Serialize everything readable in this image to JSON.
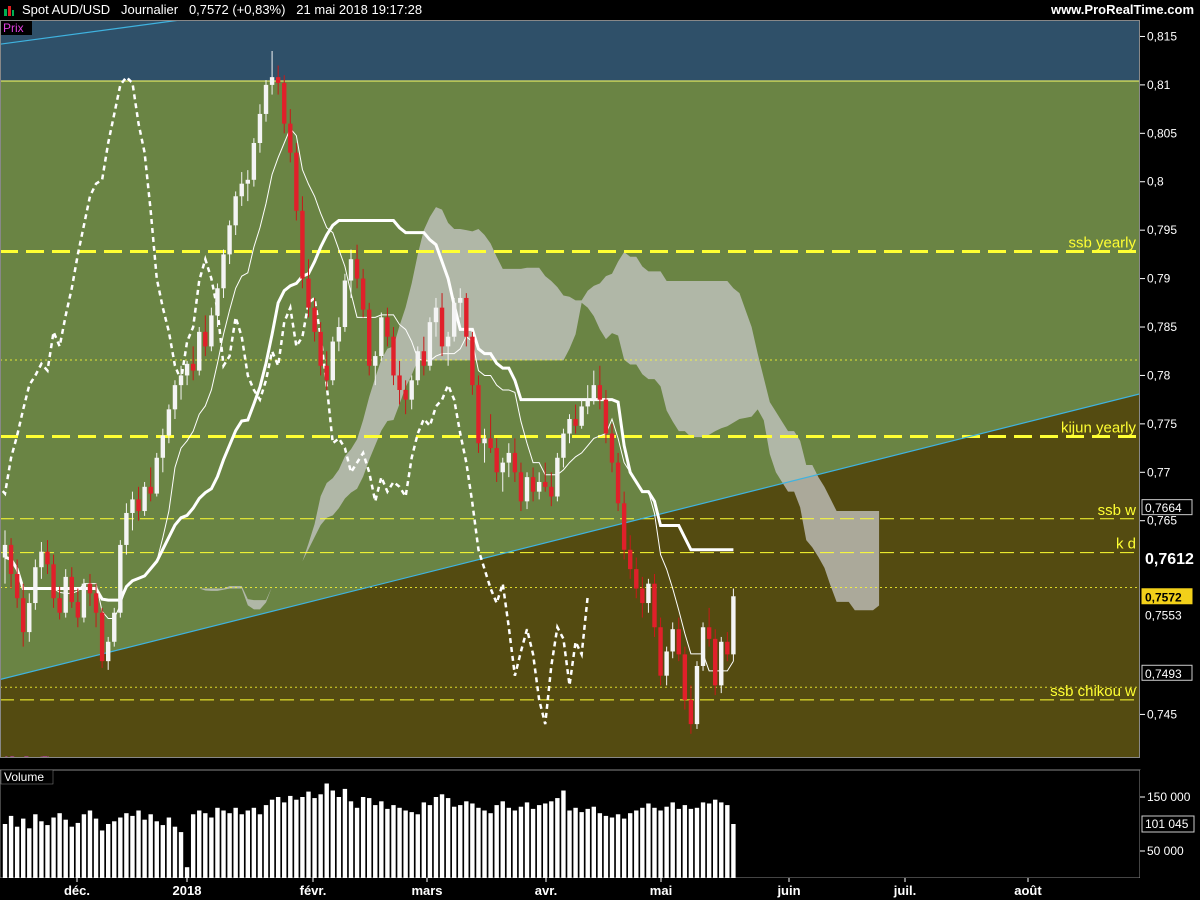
{
  "header": {
    "symbol": "Spot AUD/USD",
    "period": "Journalier",
    "last": "0,7572",
    "change": "(+0,83%)",
    "datetime": "21 mai 2018 19:17:28",
    "brand": "www.ProRealTime.com"
  },
  "price_panel": {
    "label": "Prix",
    "watermark": "©ProRealTime.com",
    "y_ticks": [
      "0,815",
      "0,81",
      "0,805",
      "0,8",
      "0,795",
      "0,79",
      "0,785",
      "0,78",
      "0,775",
      "0,77",
      "0,765",
      "0,745"
    ],
    "levels": [
      {
        "name": "ssb  yearly",
        "value": 0.7928,
        "style": "thick"
      },
      {
        "name": "kijun yearly",
        "value": 0.7737,
        "style": "thick"
      },
      {
        "name": "ssb w",
        "value": 0.7652,
        "style": "thin"
      },
      {
        "name": "k d",
        "value": 0.7617,
        "style": "thin"
      },
      {
        "name": "ssb chikou w",
        "value": 0.7465,
        "style": "thin"
      }
    ],
    "dotted_levels": [
      0.7816,
      0.7581,
      0.7478
    ],
    "value_tags": [
      {
        "text": "0,7664",
        "value": 0.7664,
        "style": "box"
      },
      {
        "text": "0,7612",
        "value": 0.7612,
        "style": "big"
      },
      {
        "text": "0,7572",
        "value": 0.7572,
        "style": "current"
      },
      {
        "text": "0,7553",
        "value": 0.7553,
        "style": "plain"
      },
      {
        "text": "0,7493",
        "value": 0.7493,
        "style": "box"
      }
    ],
    "colors": {
      "top_zone": "#2f5069",
      "mid_zone": "#6a8444",
      "low_zone": "#544b11",
      "level_line": "#ffff33",
      "level_text": "#ffff33",
      "trend": "#3fb3e0",
      "bull": "#f4f4f4",
      "bear": "#e0202a",
      "cloud": "#c8c8c8",
      "kijun": "#ffffff"
    }
  },
  "volume_panel": {
    "label": "Volume",
    "y_ticks": [
      "150 000",
      "50 000"
    ],
    "tag": "101 045",
    "bar_color": "#ffffff"
  },
  "x_axis": {
    "labels": [
      "déc.",
      "2018",
      "févr.",
      "mars",
      "avr.",
      "mai",
      "juin",
      "juil.",
      "août"
    ]
  },
  "chart_data": {
    "type": "candlestick",
    "symbol": "Spot AUD/USD",
    "ylim": [
      0.7405,
      0.8167
    ],
    "ohlc": [
      [
        0.7612,
        0.764,
        0.7585,
        0.7625
      ],
      [
        0.7625,
        0.7632,
        0.758,
        0.7595
      ],
      [
        0.7595,
        0.761,
        0.756,
        0.757
      ],
      [
        0.757,
        0.7585,
        0.752,
        0.7535
      ],
      [
        0.7535,
        0.7575,
        0.7525,
        0.7565
      ],
      [
        0.7565,
        0.761,
        0.7558,
        0.7602
      ],
      [
        0.7602,
        0.7628,
        0.759,
        0.7618
      ],
      [
        0.7618,
        0.763,
        0.7595,
        0.7605
      ],
      [
        0.7605,
        0.7615,
        0.756,
        0.757
      ],
      [
        0.757,
        0.7582,
        0.7548,
        0.7555
      ],
      [
        0.7555,
        0.76,
        0.755,
        0.7592
      ],
      [
        0.7592,
        0.7602,
        0.756,
        0.7566
      ],
      [
        0.7566,
        0.758,
        0.754,
        0.755
      ],
      [
        0.755,
        0.759,
        0.7545,
        0.7585
      ],
      [
        0.7585,
        0.7595,
        0.7562,
        0.7575
      ],
      [
        0.7575,
        0.7585,
        0.754,
        0.7555
      ],
      [
        0.7555,
        0.756,
        0.7498,
        0.7505
      ],
      [
        0.7505,
        0.753,
        0.7496,
        0.7525
      ],
      [
        0.7525,
        0.756,
        0.752,
        0.7555
      ],
      [
        0.7555,
        0.763,
        0.755,
        0.7625
      ],
      [
        0.7625,
        0.7668,
        0.7615,
        0.7658
      ],
      [
        0.7658,
        0.768,
        0.764,
        0.7672
      ],
      [
        0.7672,
        0.7685,
        0.765,
        0.766
      ],
      [
        0.766,
        0.769,
        0.7655,
        0.7685
      ],
      [
        0.7685,
        0.7705,
        0.767,
        0.7678
      ],
      [
        0.7678,
        0.772,
        0.7675,
        0.7715
      ],
      [
        0.7715,
        0.7745,
        0.77,
        0.7738
      ],
      [
        0.7738,
        0.777,
        0.773,
        0.7765
      ],
      [
        0.7765,
        0.7795,
        0.7755,
        0.779
      ],
      [
        0.779,
        0.781,
        0.7775,
        0.78
      ],
      [
        0.78,
        0.7815,
        0.779,
        0.7812
      ],
      [
        0.7812,
        0.783,
        0.7795,
        0.7805
      ],
      [
        0.7805,
        0.785,
        0.78,
        0.7845
      ],
      [
        0.7845,
        0.7862,
        0.782,
        0.783
      ],
      [
        0.783,
        0.787,
        0.7825,
        0.7862
      ],
      [
        0.7862,
        0.7895,
        0.785,
        0.789
      ],
      [
        0.789,
        0.793,
        0.788,
        0.7925
      ],
      [
        0.7925,
        0.796,
        0.7915,
        0.7955
      ],
      [
        0.7955,
        0.799,
        0.7945,
        0.7985
      ],
      [
        0.7985,
        0.801,
        0.7975,
        0.7998
      ],
      [
        0.7998,
        0.8012,
        0.798,
        0.8002
      ],
      [
        0.8002,
        0.8045,
        0.7995,
        0.804
      ],
      [
        0.804,
        0.808,
        0.803,
        0.807
      ],
      [
        0.807,
        0.8105,
        0.8062,
        0.81
      ],
      [
        0.81,
        0.8135,
        0.809,
        0.8108
      ],
      [
        0.8108,
        0.812,
        0.809,
        0.8102
      ],
      [
        0.8102,
        0.811,
        0.805,
        0.806
      ],
      [
        0.806,
        0.8075,
        0.802,
        0.803
      ],
      [
        0.803,
        0.804,
        0.796,
        0.797
      ],
      [
        0.797,
        0.7985,
        0.789,
        0.79
      ],
      [
        0.79,
        0.792,
        0.786,
        0.787
      ],
      [
        0.787,
        0.788,
        0.7835,
        0.7845
      ],
      [
        0.7845,
        0.7855,
        0.78,
        0.781
      ],
      [
        0.781,
        0.7825,
        0.7785,
        0.7795
      ],
      [
        0.7795,
        0.784,
        0.779,
        0.7835
      ],
      [
        0.7835,
        0.786,
        0.7825,
        0.785
      ],
      [
        0.785,
        0.7905,
        0.7845,
        0.7898
      ],
      [
        0.7898,
        0.793,
        0.788,
        0.792
      ],
      [
        0.792,
        0.7935,
        0.789,
        0.79
      ],
      [
        0.79,
        0.791,
        0.786,
        0.7868
      ],
      [
        0.7868,
        0.7875,
        0.78,
        0.781
      ],
      [
        0.781,
        0.7825,
        0.779,
        0.782
      ],
      [
        0.782,
        0.7865,
        0.7815,
        0.786
      ],
      [
        0.786,
        0.787,
        0.783,
        0.784
      ],
      [
        0.784,
        0.785,
        0.779,
        0.78
      ],
      [
        0.78,
        0.7815,
        0.777,
        0.7785
      ],
      [
        0.7785,
        0.7795,
        0.776,
        0.7775
      ],
      [
        0.7775,
        0.78,
        0.7765,
        0.7795
      ],
      [
        0.7795,
        0.783,
        0.779,
        0.7825
      ],
      [
        0.7825,
        0.784,
        0.78,
        0.781
      ],
      [
        0.781,
        0.786,
        0.7805,
        0.7855
      ],
      [
        0.7855,
        0.788,
        0.784,
        0.787
      ],
      [
        0.787,
        0.7885,
        0.782,
        0.783
      ],
      [
        0.783,
        0.7845,
        0.781,
        0.784
      ],
      [
        0.784,
        0.788,
        0.7835,
        0.7875
      ],
      [
        0.7875,
        0.789,
        0.786,
        0.788
      ],
      [
        0.788,
        0.7885,
        0.783,
        0.784
      ],
      [
        0.784,
        0.7845,
        0.778,
        0.779
      ],
      [
        0.779,
        0.78,
        0.772,
        0.773
      ],
      [
        0.773,
        0.7745,
        0.771,
        0.7735
      ],
      [
        0.7735,
        0.776,
        0.772,
        0.7725
      ],
      [
        0.7725,
        0.7735,
        0.769,
        0.77
      ],
      [
        0.77,
        0.7715,
        0.768,
        0.771
      ],
      [
        0.771,
        0.773,
        0.7695,
        0.772
      ],
      [
        0.772,
        0.7735,
        0.769,
        0.77
      ],
      [
        0.77,
        0.771,
        0.766,
        0.767
      ],
      [
        0.767,
        0.77,
        0.7662,
        0.7695
      ],
      [
        0.7695,
        0.7705,
        0.767,
        0.768
      ],
      [
        0.768,
        0.77,
        0.7672,
        0.769
      ],
      [
        0.769,
        0.771,
        0.768,
        0.7685
      ],
      [
        0.7685,
        0.77,
        0.7665,
        0.7675
      ],
      [
        0.7675,
        0.772,
        0.767,
        0.7715
      ],
      [
        0.7715,
        0.7745,
        0.7705,
        0.774
      ],
      [
        0.774,
        0.776,
        0.773,
        0.7755
      ],
      [
        0.7755,
        0.777,
        0.774,
        0.7748
      ],
      [
        0.7748,
        0.7775,
        0.7745,
        0.7768
      ],
      [
        0.7768,
        0.779,
        0.776,
        0.7775
      ],
      [
        0.7775,
        0.7805,
        0.777,
        0.779
      ],
      [
        0.779,
        0.781,
        0.7765,
        0.7775
      ],
      [
        0.7775,
        0.7785,
        0.773,
        0.774
      ],
      [
        0.774,
        0.775,
        0.77,
        0.771
      ],
      [
        0.771,
        0.772,
        0.766,
        0.7668
      ],
      [
        0.7668,
        0.768,
        0.761,
        0.762
      ],
      [
        0.762,
        0.7635,
        0.759,
        0.76
      ],
      [
        0.76,
        0.7612,
        0.757,
        0.758
      ],
      [
        0.758,
        0.7592,
        0.755,
        0.7565
      ],
      [
        0.7565,
        0.759,
        0.7555,
        0.7585
      ],
      [
        0.7585,
        0.7595,
        0.753,
        0.754
      ],
      [
        0.754,
        0.755,
        0.748,
        0.749
      ],
      [
        0.749,
        0.752,
        0.748,
        0.7515
      ],
      [
        0.7515,
        0.7545,
        0.7508,
        0.7538
      ],
      [
        0.7538,
        0.755,
        0.7505,
        0.7512
      ],
      [
        0.7512,
        0.752,
        0.7455,
        0.7465
      ],
      [
        0.7465,
        0.748,
        0.743,
        0.744
      ],
      [
        0.744,
        0.7505,
        0.7435,
        0.75
      ],
      [
        0.75,
        0.7545,
        0.7495,
        0.754
      ],
      [
        0.754,
        0.756,
        0.752,
        0.7528
      ],
      [
        0.7528,
        0.7538,
        0.747,
        0.748
      ],
      [
        0.748,
        0.753,
        0.7472,
        0.7525
      ],
      [
        0.7525,
        0.7535,
        0.7505,
        0.7512
      ],
      [
        0.7512,
        0.758,
        0.7505,
        0.7572
      ]
    ],
    "volume": [
      100000,
      115000,
      95000,
      110000,
      92000,
      118000,
      105000,
      98000,
      112000,
      120000,
      108000,
      95000,
      102000,
      118000,
      125000,
      110000,
      88000,
      100000,
      105000,
      112000,
      120000,
      115000,
      125000,
      108000,
      118000,
      105000,
      98000,
      112000,
      95000,
      85000,
      20000,
      118000,
      125000,
      120000,
      112000,
      130000,
      125000,
      120000,
      130000,
      118000,
      125000,
      130000,
      118000,
      135000,
      145000,
      150000,
      140000,
      152000,
      145000,
      150000,
      160000,
      148000,
      155000,
      175000,
      162000,
      150000,
      165000,
      142000,
      130000,
      150000,
      148000,
      135000,
      142000,
      128000,
      135000,
      130000,
      125000,
      122000,
      118000,
      140000,
      135000,
      150000,
      155000,
      148000,
      132000,
      135000,
      142000,
      138000,
      130000,
      125000,
      120000,
      135000,
      142000,
      130000,
      125000,
      132000,
      140000,
      128000,
      135000,
      138000,
      142000,
      148000,
      162000,
      125000,
      130000,
      122000,
      128000,
      132000,
      120000,
      115000,
      112000,
      118000,
      110000,
      120000,
      125000,
      130000,
      138000,
      130000,
      125000,
      132000,
      140000,
      128000,
      135000,
      128000,
      130000,
      140000,
      138000,
      145000,
      140000,
      135000,
      100000
    ]
  }
}
